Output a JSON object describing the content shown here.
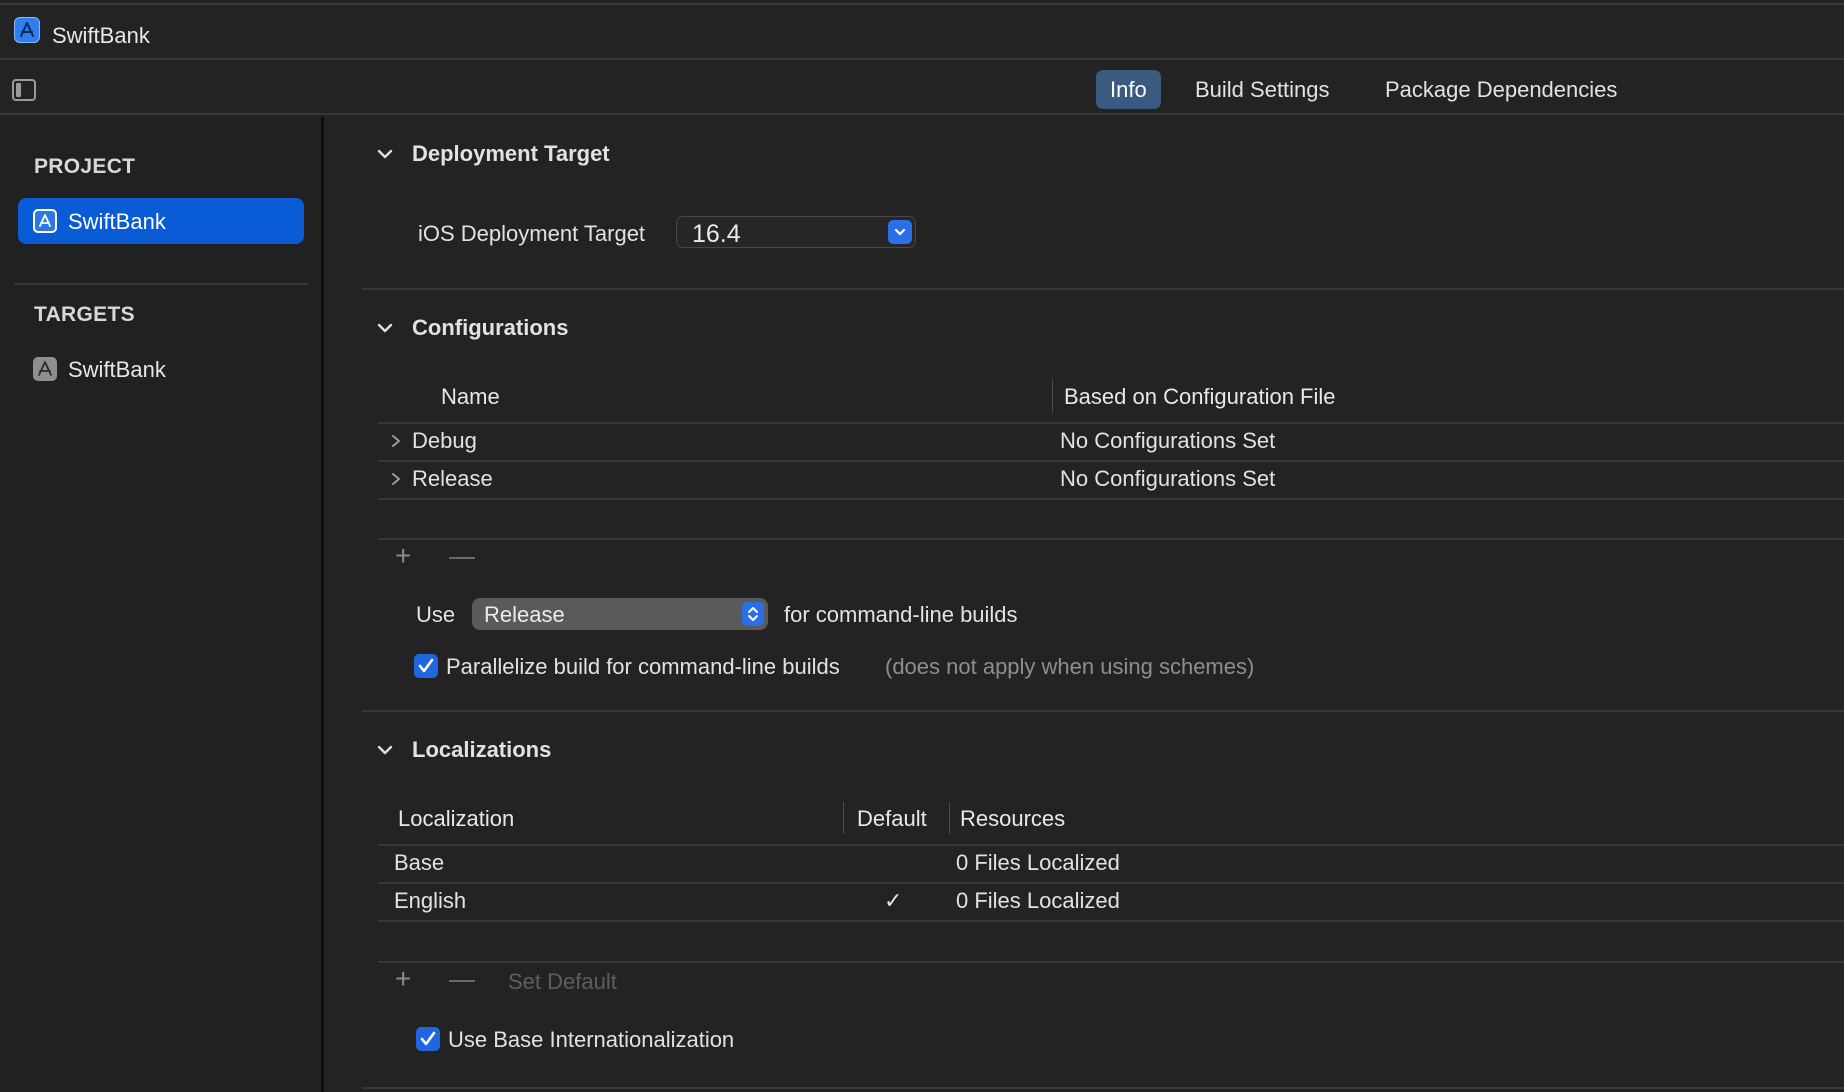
{
  "window": {
    "title": "SwiftBank",
    "app_icon": "xcode-project-icon"
  },
  "tabs": [
    {
      "label": "Info",
      "active": true
    },
    {
      "label": "Build Settings",
      "active": false
    },
    {
      "label": "Package Dependencies",
      "active": false
    }
  ],
  "sidebar": {
    "project_heading": "PROJECT",
    "project_items": [
      {
        "label": "SwiftBank",
        "icon": "project-icon",
        "selected": true
      }
    ],
    "targets_heading": "TARGETS",
    "target_items": [
      {
        "label": "SwiftBank",
        "icon": "app-target-icon",
        "selected": false
      }
    ]
  },
  "deployment": {
    "title": "Deployment Target",
    "field_label": "iOS Deployment Target",
    "value": "16.4"
  },
  "configurations": {
    "title": "Configurations",
    "columns": [
      "Name",
      "Based on Configuration File"
    ],
    "rows": [
      {
        "name": "Debug",
        "file": "No Configurations Set"
      },
      {
        "name": "Release",
        "file": "No Configurations Set"
      }
    ],
    "add_label": "+",
    "remove_label": "−",
    "use_label": "Use",
    "cmdline_config": "Release",
    "cmdline_suffix": "for command-line builds",
    "parallelize_label": "Parallelize build for command-line builds",
    "parallelize_checked": true,
    "parallelize_note": "(does not apply when using schemes)"
  },
  "localizations": {
    "title": "Localizations",
    "columns": [
      "Localization",
      "Default",
      "Resources"
    ],
    "rows": [
      {
        "name": "Base",
        "default": "",
        "resources": "0 Files Localized"
      },
      {
        "name": "English",
        "default": "✓",
        "resources": "0 Files Localized"
      }
    ],
    "add_label": "+",
    "remove_label": "−",
    "set_default_label": "Set Default",
    "use_base_label": "Use Base Internationalization",
    "use_base_checked": true
  },
  "colors": {
    "accent": "#0a5bd6",
    "active_tab": "#3b5a80",
    "background": "#232323"
  }
}
